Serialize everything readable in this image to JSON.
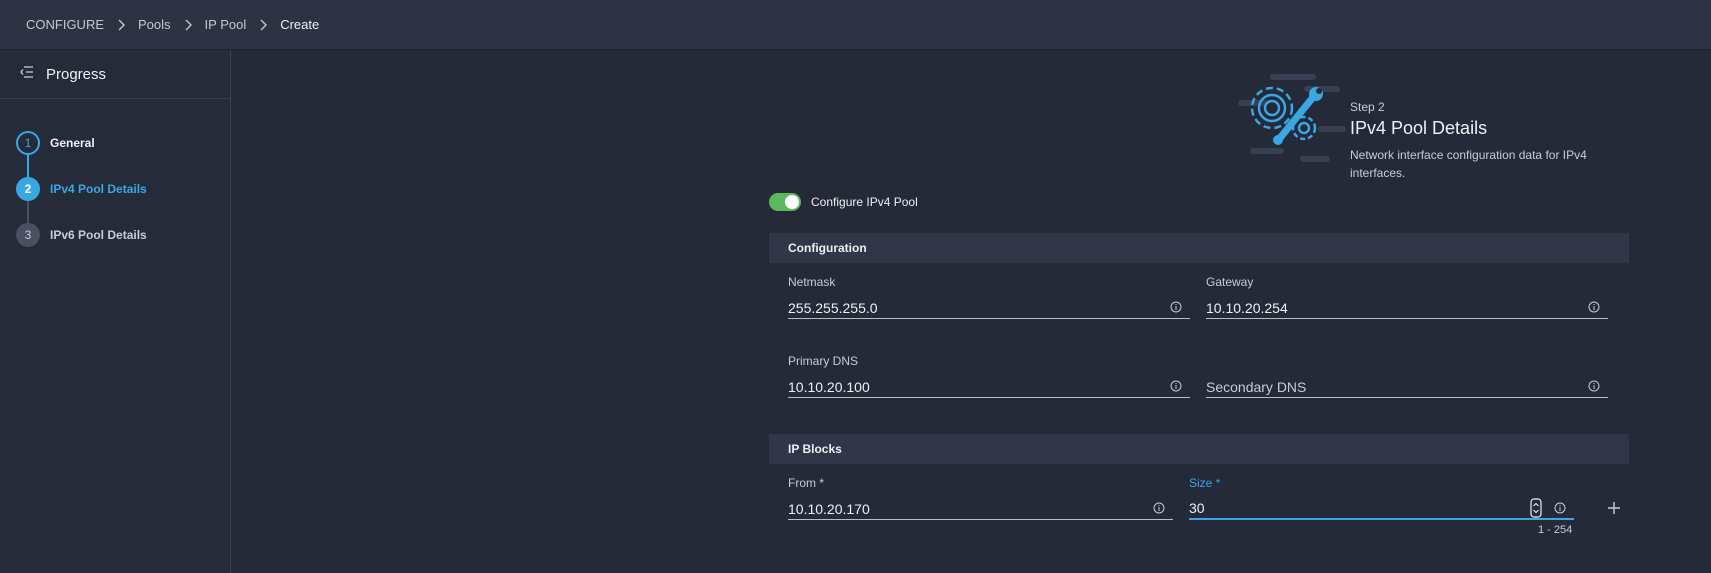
{
  "breadcrumb": [
    "CONFIGURE",
    "Pools",
    "IP Pool",
    "Create"
  ],
  "sidebar": {
    "title": "Progress",
    "steps": [
      {
        "number": "1",
        "label": "General",
        "state": "done"
      },
      {
        "number": "2",
        "label": "IPv4 Pool Details",
        "state": "active"
      },
      {
        "number": "3",
        "label": "IPv6 Pool Details",
        "state": "pending"
      }
    ]
  },
  "header": {
    "step": "Step 2",
    "title": "IPv4 Pool Details",
    "description": "Network interface configuration data for IPv4 interfaces."
  },
  "toggle": {
    "label": "Configure IPv4 Pool",
    "on": true
  },
  "configuration": {
    "section_title": "Configuration",
    "netmask": {
      "label": "Netmask",
      "value": "255.255.255.0"
    },
    "gateway": {
      "label": "Gateway",
      "value": "10.10.20.254"
    },
    "primary_dns": {
      "label": "Primary DNS",
      "value": "10.10.20.100"
    },
    "secondary_dns": {
      "placeholder": "Secondary DNS",
      "value": ""
    }
  },
  "ip_blocks": {
    "section_title": "IP Blocks",
    "from": {
      "label": "From *",
      "value": "10.10.20.170"
    },
    "size": {
      "label": "Size *",
      "value": "30",
      "hint": "1 - 254"
    }
  },
  "colors": {
    "accent": "#38a7e4",
    "toggle_on": "#5cb85c",
    "background": "#252a39",
    "topbar": "#2e3344",
    "section": "#313648"
  },
  "icons": [
    "chevron-right-icon",
    "collapse-menu-icon",
    "gear-wrench-icon",
    "info-icon",
    "stepper-icon",
    "plus-icon"
  ]
}
